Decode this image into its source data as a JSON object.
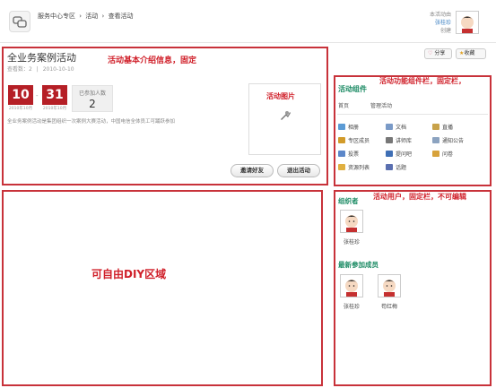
{
  "breadcrumb": [
    "服务中心专区",
    "›",
    "活动",
    "›",
    "查看活动"
  ],
  "creator": {
    "title": "本活动由",
    "name": "张桂珍",
    "suffix": "创建"
  },
  "activity": {
    "title": "全业务案例活动",
    "views_label": "查看数：2",
    "separator": "|",
    "date": "2010-10-10",
    "start_day": "10",
    "end_day": "31",
    "start_label": "2010年10月",
    "end_label": "2010年10月",
    "date_separator": "-",
    "joined_label": "已参加人数",
    "joined_count": "2",
    "description": "全业务案例活动是集团组织一次案例大赛活动，中国电信全体员工可踊跃参加",
    "image_label": "活动图片",
    "invite_label": "邀请好友",
    "quit_label": "退出活动"
  },
  "actions": {
    "share_label": "分享",
    "fav_label": "收藏"
  },
  "notes": {
    "info": "活动基本介绍信息，固定",
    "widget": "活动功能组件栏，固定栏，",
    "users": "活动用户，固定栏，不可编辑",
    "diy": "可自由DIY区域"
  },
  "widgets": {
    "title": "活动组件",
    "nav": [
      "首页",
      "管理活动"
    ],
    "items": [
      {
        "label": "相册",
        "icon": "photo-icon",
        "color": "#5b9bd5"
      },
      {
        "label": "文档",
        "icon": "document-icon",
        "color": "#7a9ac7"
      },
      {
        "label": "直播",
        "icon": "speaker-icon",
        "color": "#c8a24a"
      },
      {
        "label": "专区成员",
        "icon": "members-icon",
        "color": "#d29b2a"
      },
      {
        "label": "讲师库",
        "icon": "teacher-icon",
        "color": "#777777"
      },
      {
        "label": "通知公告",
        "icon": "notice-icon",
        "color": "#8ca3c0"
      },
      {
        "label": "投票",
        "icon": "vote-icon",
        "color": "#5c87c9"
      },
      {
        "label": "提问吧",
        "icon": "question-icon",
        "color": "#3f6fb5"
      },
      {
        "label": "问卷",
        "icon": "survey-icon",
        "color": "#d7a23b"
      },
      {
        "label": "资源列表",
        "icon": "resource-icon",
        "color": "#e0b040"
      },
      {
        "label": "话题",
        "icon": "topic-icon",
        "color": "#5a6fb0"
      }
    ]
  },
  "users": {
    "organizer_title": "组织者",
    "organizers": [
      {
        "name": "张桂珍"
      }
    ],
    "members_title": "最新参加成员",
    "members": [
      {
        "name": "张桂珍"
      },
      {
        "name": "苟红梅"
      }
    ]
  }
}
